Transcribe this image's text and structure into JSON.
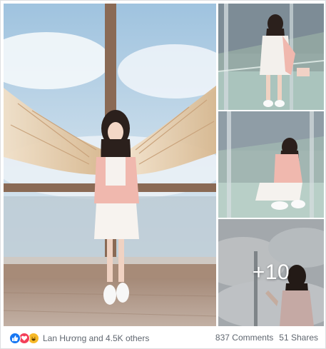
{
  "post": {
    "photos": [
      {
        "name": "angel-wings-photo"
      },
      {
        "name": "glass-floor-standing-photo"
      },
      {
        "name": "glass-floor-sitting-photo"
      },
      {
        "name": "cloud-window-photo"
      }
    ],
    "more_photos_label": "+10"
  },
  "reactions": {
    "icons": [
      "like-icon",
      "love-icon",
      "haha-icon"
    ],
    "summary": "Lan Hương and 4.5K others",
    "colors": {
      "like": "#1877f2",
      "love": "#f33e58",
      "haha": "#f7b928"
    }
  },
  "stats": {
    "comments": "837 Comments",
    "shares": "51 Shares"
  },
  "colors": {
    "text_secondary": "#606770",
    "border": "#dddfe2"
  }
}
